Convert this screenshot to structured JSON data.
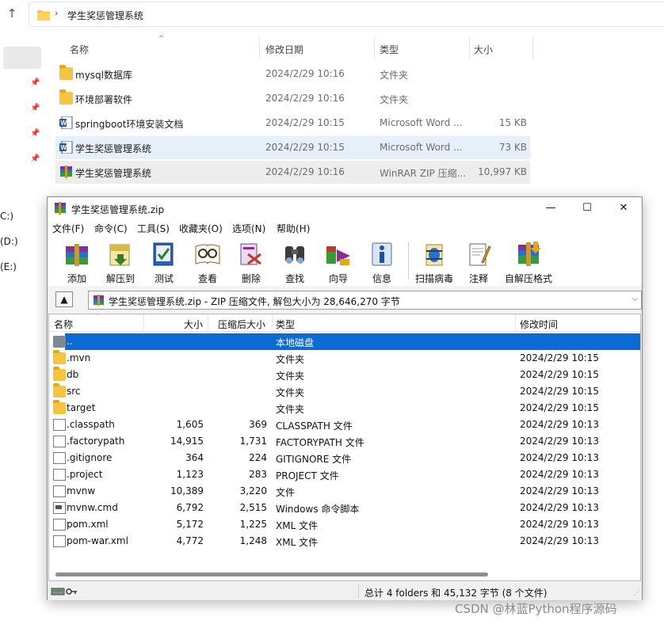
{
  "explorer": {
    "breadcrumb": "学生奖惩管理系统",
    "columns": {
      "name": "名称",
      "date": "修改日期",
      "type": "类型",
      "size": "大小"
    },
    "drives": [
      "C:)",
      "(D:)",
      "(E:)"
    ],
    "files": [
      {
        "name": "mysql数据库",
        "date": "2024/2/29 10:16",
        "type": "文件夹",
        "size": "",
        "icon": "folder-icon"
      },
      {
        "name": "环境部署软件",
        "date": "2024/2/29 10:16",
        "type": "文件夹",
        "size": "",
        "icon": "folder-icon"
      },
      {
        "name": "springboot环境安装文档",
        "date": "2024/2/29 10:15",
        "type": "Microsoft Word ...",
        "size": "15 KB",
        "icon": "word-doc-icon"
      },
      {
        "name": "学生奖惩管理系统",
        "date": "2024/2/29 10:15",
        "type": "Microsoft Word ...",
        "size": "73 KB",
        "icon": "word-doc-icon"
      },
      {
        "name": "学生奖惩管理系统",
        "date": "2024/2/29 10:16",
        "type": "WinRAR ZIP 压缩...",
        "size": "10,997 KB",
        "icon": "winrar-archive-icon"
      }
    ]
  },
  "rar": {
    "title": "学生奖惩管理系统.zip",
    "window_buttons": {
      "minimize": "—",
      "maximize": "☐",
      "close": "✕"
    },
    "menu": [
      "文件(F)",
      "命令(C)",
      "工具(S)",
      "收藏夹(O)",
      "选项(N)",
      "帮助(H)"
    ],
    "toolbar": [
      {
        "label": "添加",
        "icon": "add-archive-icon"
      },
      {
        "label": "解压到",
        "icon": "extract-to-icon"
      },
      {
        "label": "测试",
        "icon": "test-icon"
      },
      {
        "label": "查看",
        "icon": "view-icon"
      },
      {
        "label": "删除",
        "icon": "delete-icon"
      },
      {
        "label": "查找",
        "icon": "find-icon"
      },
      {
        "label": "向导",
        "icon": "wizard-icon"
      },
      {
        "label": "信息",
        "icon": "info-icon"
      },
      {
        "label": "扫描病毒",
        "icon": "scan-virus-icon"
      },
      {
        "label": "注释",
        "icon": "comment-icon"
      },
      {
        "label": "自解压格式",
        "icon": "sfx-icon"
      }
    ],
    "path": "学生奖惩管理系统.zip - ZIP 压缩文件, 解包大小为 28,646,270 字节",
    "columns": {
      "name": "名称",
      "size": "大小",
      "packed": "压缩后大小",
      "type": "类型",
      "modified": "修改时间"
    },
    "rows": [
      {
        "name": "..",
        "size": "",
        "packed": "",
        "type": "本地磁盘",
        "modified": "",
        "icon": "parent-disk-icon"
      },
      {
        "name": ".mvn",
        "size": "",
        "packed": "",
        "type": "文件夹",
        "modified": "2024/2/29 10:15",
        "icon": "folder-icon"
      },
      {
        "name": "db",
        "size": "",
        "packed": "",
        "type": "文件夹",
        "modified": "2024/2/29 10:15",
        "icon": "folder-icon"
      },
      {
        "name": "src",
        "size": "",
        "packed": "",
        "type": "文件夹",
        "modified": "2024/2/29 10:15",
        "icon": "folder-icon"
      },
      {
        "name": "target",
        "size": "",
        "packed": "",
        "type": "文件夹",
        "modified": "2024/2/29 10:15",
        "icon": "folder-icon"
      },
      {
        "name": ".classpath",
        "size": "1,605",
        "packed": "369",
        "type": "CLASSPATH 文件",
        "modified": "2024/2/29 10:13",
        "icon": "file-icon"
      },
      {
        "name": ".factorypath",
        "size": "14,915",
        "packed": "1,731",
        "type": "FACTORYPATH 文件",
        "modified": "2024/2/29 10:13",
        "icon": "file-icon"
      },
      {
        "name": ".gitignore",
        "size": "364",
        "packed": "224",
        "type": "GITIGNORE 文件",
        "modified": "2024/2/29 10:13",
        "icon": "file-icon"
      },
      {
        "name": ".project",
        "size": "1,123",
        "packed": "283",
        "type": "PROJECT 文件",
        "modified": "2024/2/29 10:13",
        "icon": "file-icon"
      },
      {
        "name": "mvnw",
        "size": "10,389",
        "packed": "3,220",
        "type": "文件",
        "modified": "2024/2/29 10:13",
        "icon": "file-icon"
      },
      {
        "name": "mvnw.cmd",
        "size": "6,792",
        "packed": "2,515",
        "type": "Windows 命令脚本",
        "modified": "2024/2/29 10:13",
        "icon": "cmd-script-icon"
      },
      {
        "name": "pom.xml",
        "size": "5,172",
        "packed": "1,225",
        "type": "XML 文件",
        "modified": "2024/2/29 10:13",
        "icon": "file-icon"
      },
      {
        "name": "pom-war.xml",
        "size": "4,772",
        "packed": "1,248",
        "type": "XML 文件",
        "modified": "2024/2/29 10:13",
        "icon": "file-icon"
      }
    ],
    "status": "总计 4 folders 和 45,132 字节 (8 个文件)"
  },
  "watermark": "CSDN @林蓝Python程序源码",
  "colors": {
    "selection": "#0c6ad2",
    "explorer_selection": "#e5f0fb",
    "folder": "#f4c542"
  }
}
